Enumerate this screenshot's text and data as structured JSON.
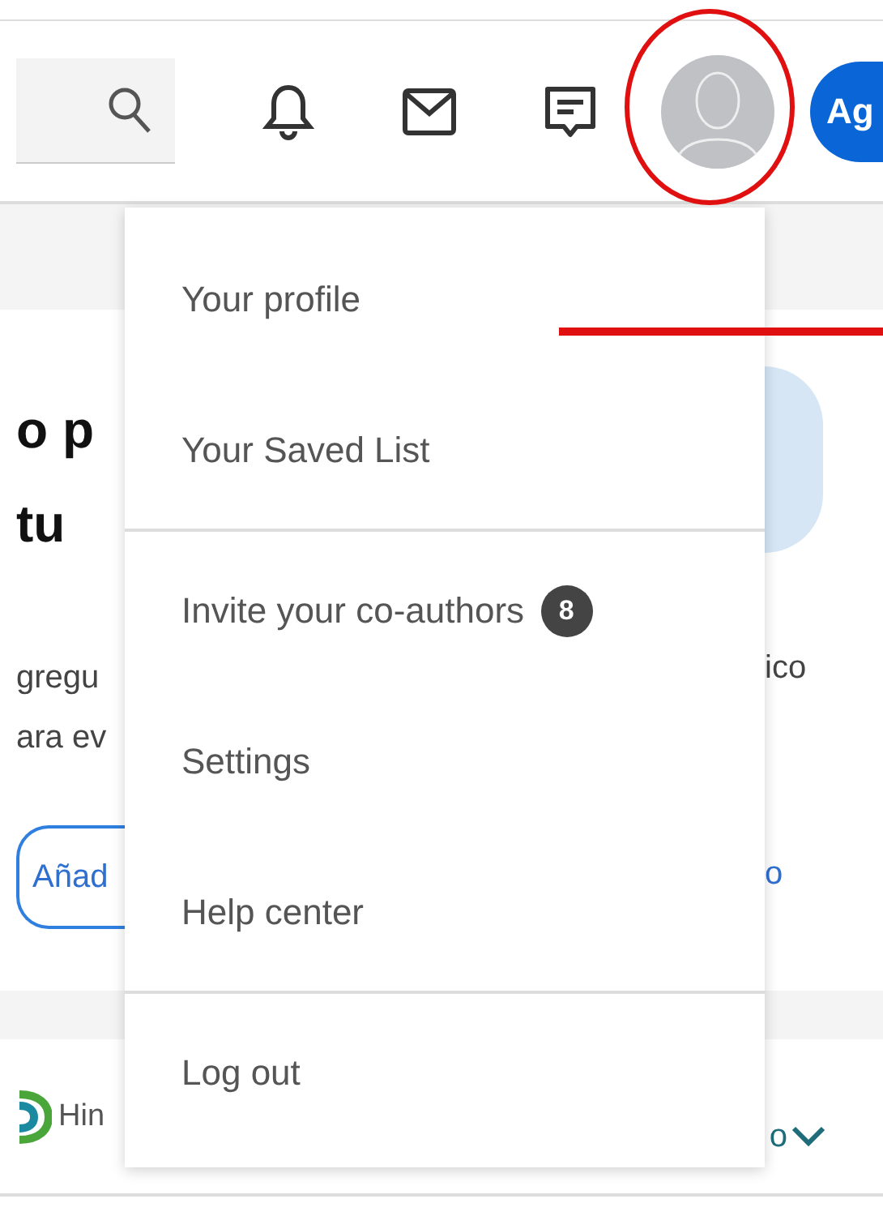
{
  "header": {
    "action_button": {
      "label": "Ag"
    }
  },
  "background": {
    "headline_lines": [
      "o p",
      "tu"
    ],
    "body_lines": [
      "gregu",
      "ara ev"
    ],
    "button": "Añad",
    "right_text": "ico",
    "right_link": "o",
    "brand": "Hin",
    "brand_side_text": "o"
  },
  "menu": {
    "sections": [
      {
        "items": [
          {
            "label": "Your profile"
          },
          {
            "label": "Your Saved List"
          }
        ]
      },
      {
        "items": [
          {
            "label": "Invite your co-authors",
            "badge": "8"
          },
          {
            "label": "Settings"
          },
          {
            "label": "Help center"
          }
        ]
      },
      {
        "items": [
          {
            "label": "Log out"
          }
        ]
      }
    ]
  }
}
